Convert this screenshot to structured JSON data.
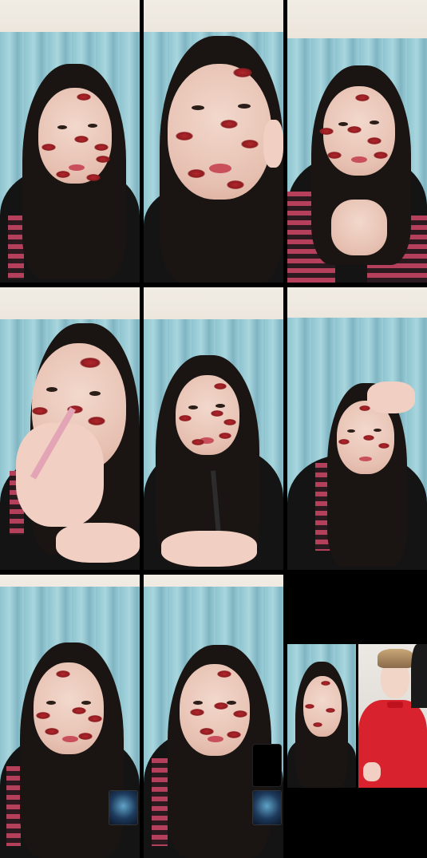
{
  "layout": "video-call-collage",
  "tiles": [
    {
      "id": "tile-1",
      "subject": "girl-face-kiss-stickers"
    },
    {
      "id": "tile-2",
      "subject": "girl-face-closeup-eyeliner"
    },
    {
      "id": "tile-3",
      "subject": "girl-face-striped-jacket"
    },
    {
      "id": "tile-4",
      "subject": "girl-applying-makeup"
    },
    {
      "id": "tile-5",
      "subject": "girl-holding-eyeliner"
    },
    {
      "id": "tile-6",
      "subject": "girl-touching-hair"
    },
    {
      "id": "tile-7",
      "subject": "girl-with-thumbnail"
    },
    {
      "id": "tile-8",
      "subject": "girl-with-two-thumbnails"
    },
    {
      "id": "tile-9",
      "subject": "split-girl-and-man-red-suit"
    }
  ],
  "colors": {
    "background": "#000000",
    "curtain": "#9ccdd7",
    "kiss_sticker": "#b3262c",
    "stripe_pink": "#b4405b",
    "red_suit": "#d8232f"
  }
}
